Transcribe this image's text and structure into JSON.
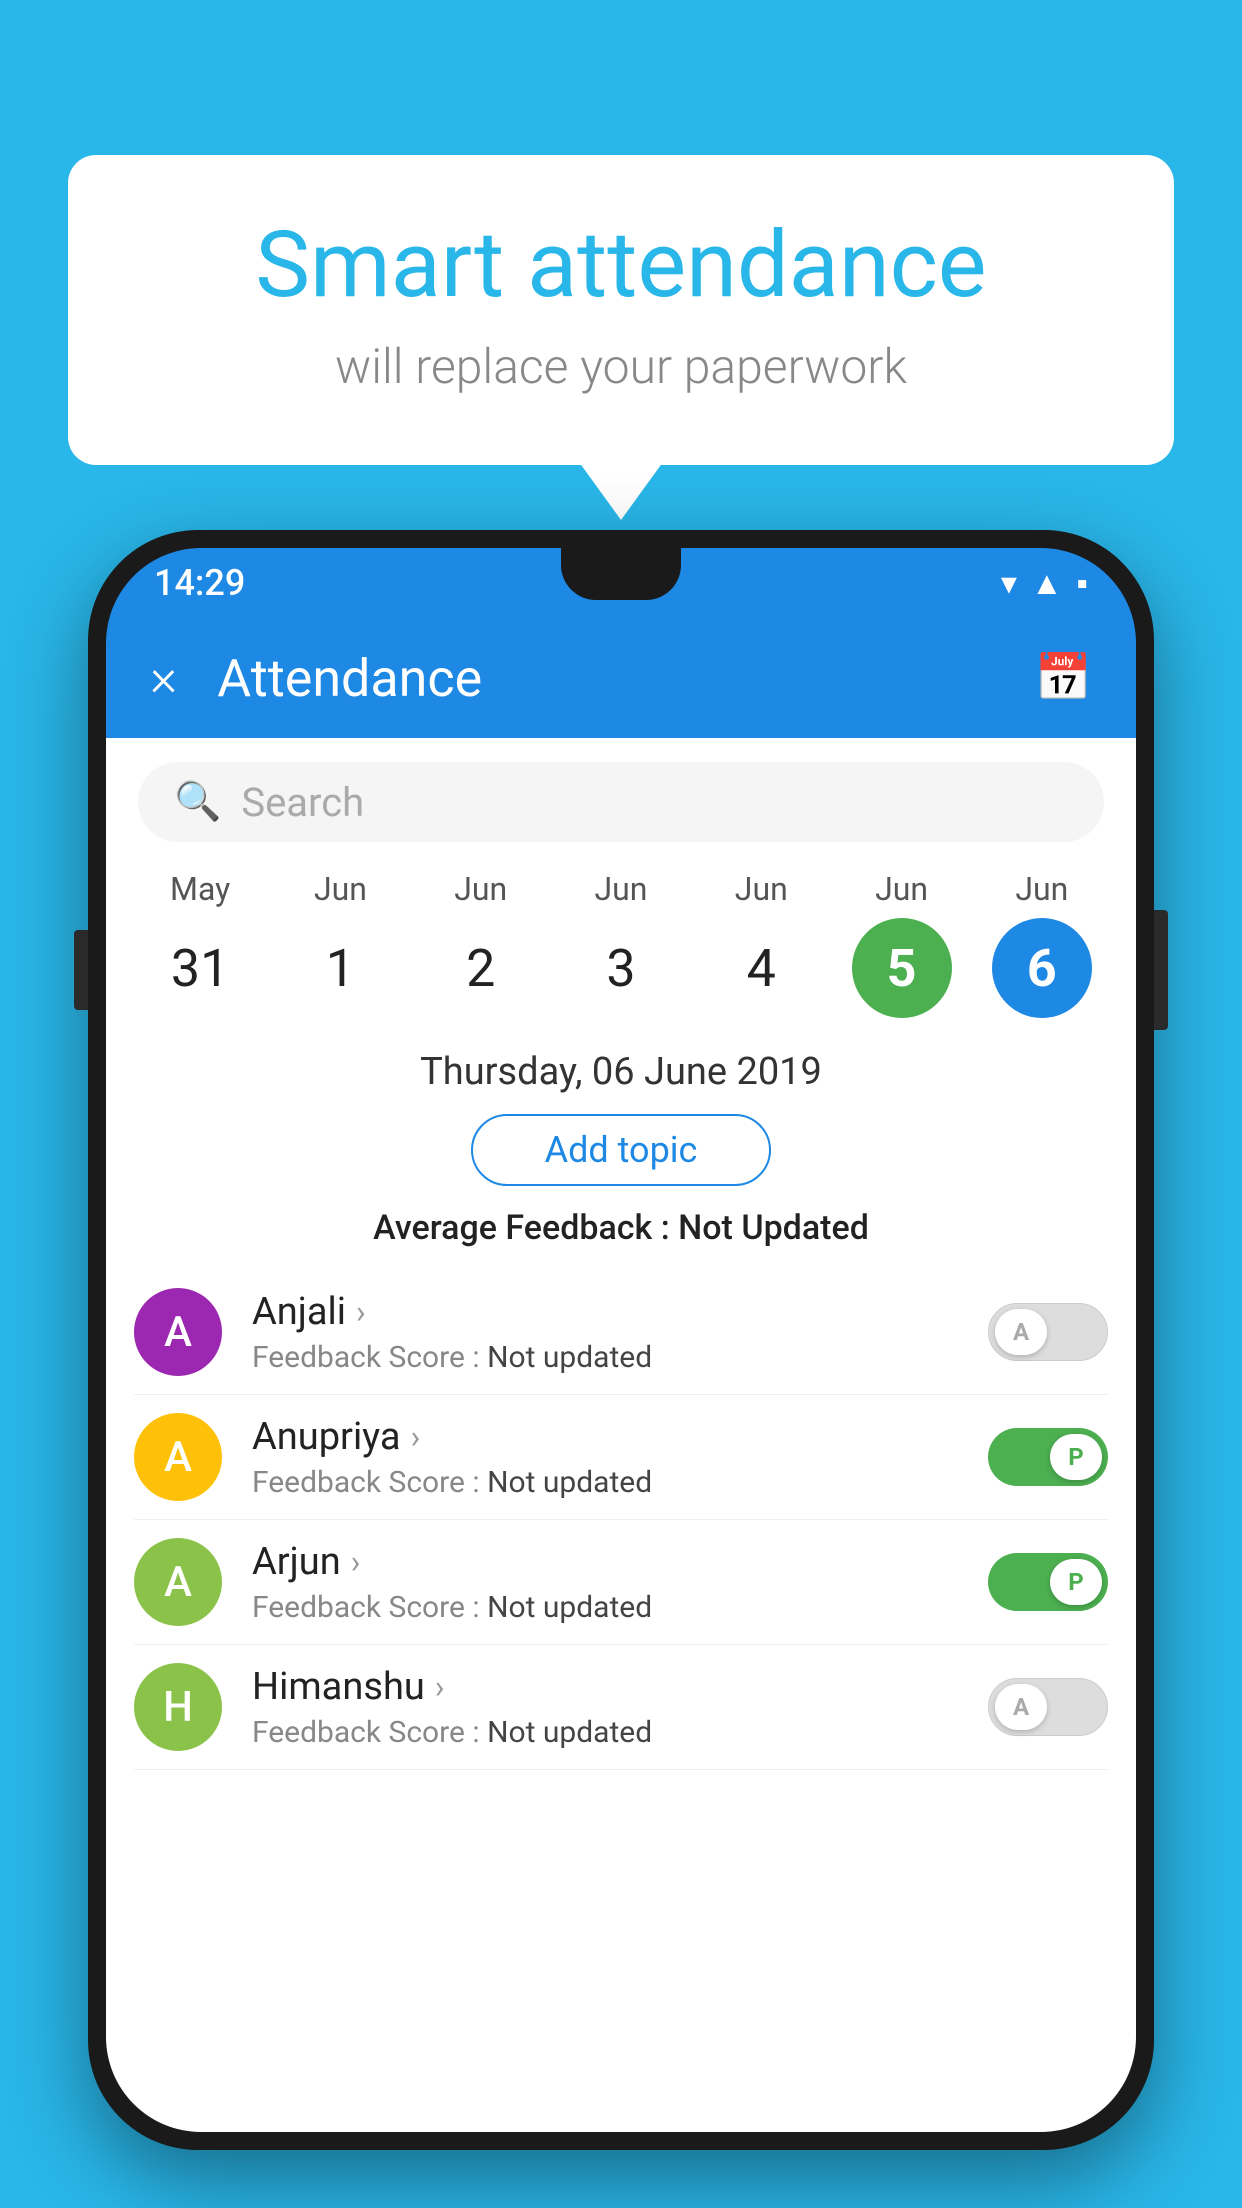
{
  "background_color": "#29B6E8",
  "speech_bubble": {
    "title": "Smart attendance",
    "subtitle": "will replace your paperwork"
  },
  "status_bar": {
    "time": "14:29",
    "icons": [
      "wifi",
      "signal",
      "battery"
    ]
  },
  "app_bar": {
    "title": "Attendance",
    "close_icon": "×",
    "calendar_icon": "📅"
  },
  "search": {
    "placeholder": "Search"
  },
  "calendar": {
    "days": [
      {
        "month": "May",
        "date": "31",
        "state": "normal"
      },
      {
        "month": "Jun",
        "date": "1",
        "state": "normal"
      },
      {
        "month": "Jun",
        "date": "2",
        "state": "normal"
      },
      {
        "month": "Jun",
        "date": "3",
        "state": "normal"
      },
      {
        "month": "Jun",
        "date": "4",
        "state": "normal"
      },
      {
        "month": "Jun",
        "date": "5",
        "state": "today"
      },
      {
        "month": "Jun",
        "date": "6",
        "state": "selected"
      }
    ]
  },
  "selected_date": "Thursday, 06 June 2019",
  "add_topic_label": "Add topic",
  "feedback_summary": {
    "label": "Average Feedback : ",
    "value": "Not Updated"
  },
  "students": [
    {
      "name": "Anjali",
      "avatar_letter": "A",
      "avatar_color": "#9C27B0",
      "feedback_label": "Feedback Score : ",
      "feedback_value": "Not updated",
      "toggle_state": "off",
      "toggle_label": "A"
    },
    {
      "name": "Anupriya",
      "avatar_letter": "A",
      "avatar_color": "#FFC107",
      "feedback_label": "Feedback Score : ",
      "feedback_value": "Not updated",
      "toggle_state": "on",
      "toggle_label": "P"
    },
    {
      "name": "Arjun",
      "avatar_letter": "A",
      "avatar_color": "#8BC34A",
      "feedback_label": "Feedback Score : ",
      "feedback_value": "Not updated",
      "toggle_state": "on",
      "toggle_label": "P"
    },
    {
      "name": "Himanshu",
      "avatar_letter": "H",
      "avatar_color": "#8BC34A",
      "feedback_label": "Feedback Score : ",
      "feedback_value": "Not updated",
      "toggle_state": "off",
      "toggle_label": "A"
    }
  ]
}
